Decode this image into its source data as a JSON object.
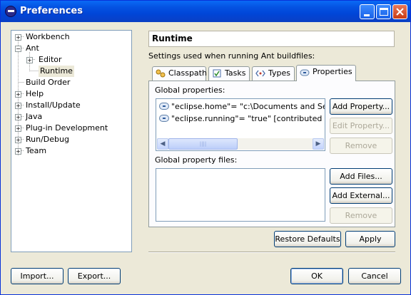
{
  "window": {
    "title": "Preferences"
  },
  "tree": {
    "items": [
      {
        "label": "Workbench",
        "expander": "+"
      },
      {
        "label": "Ant",
        "expander": "−"
      },
      {
        "label": "Editor",
        "expander": "+"
      },
      {
        "label": "Runtime",
        "expander": ""
      },
      {
        "label": "Build Order",
        "expander": ""
      },
      {
        "label": "Help",
        "expander": "+"
      },
      {
        "label": "Install/Update",
        "expander": "+"
      },
      {
        "label": "Java",
        "expander": "+"
      },
      {
        "label": "Plug-in Development",
        "expander": "+"
      },
      {
        "label": "Run/Debug",
        "expander": "+"
      },
      {
        "label": "Team",
        "expander": "+"
      }
    ]
  },
  "page": {
    "title": "Runtime",
    "description": "Settings used when running Ant buildfiles:"
  },
  "tabs": [
    {
      "label": "Classpath",
      "icon": "classpath-icon"
    },
    {
      "label": "Tasks",
      "icon": "tasks-icon"
    },
    {
      "label": "Types",
      "icon": "types-icon"
    },
    {
      "label": "Properties",
      "icon": "properties-icon"
    }
  ],
  "properties_tab": {
    "global_properties_label": "Global properties:",
    "global_properties": [
      "\"eclipse.home\"= \"c:\\Documents and Settings\\",
      "\"eclipse.running\"= \"true\" [contributed by Ant"
    ],
    "scroll_thumb": "||||",
    "add_property": "Add Property...",
    "edit_property": "Edit Property...",
    "remove_property": "Remove",
    "global_files_label": "Global property files:",
    "add_files": "Add Files...",
    "add_external": "Add External...",
    "remove_file": "Remove"
  },
  "page_buttons": {
    "restore_defaults": "Restore Defaults",
    "apply": "Apply"
  },
  "footer": {
    "import": "Import...",
    "export": "Export...",
    "ok": "OK",
    "cancel": "Cancel"
  },
  "colors": {
    "title_bar": "#0054e3",
    "dialog_bg": "#ece9d8",
    "selection": "#ece9d8"
  }
}
